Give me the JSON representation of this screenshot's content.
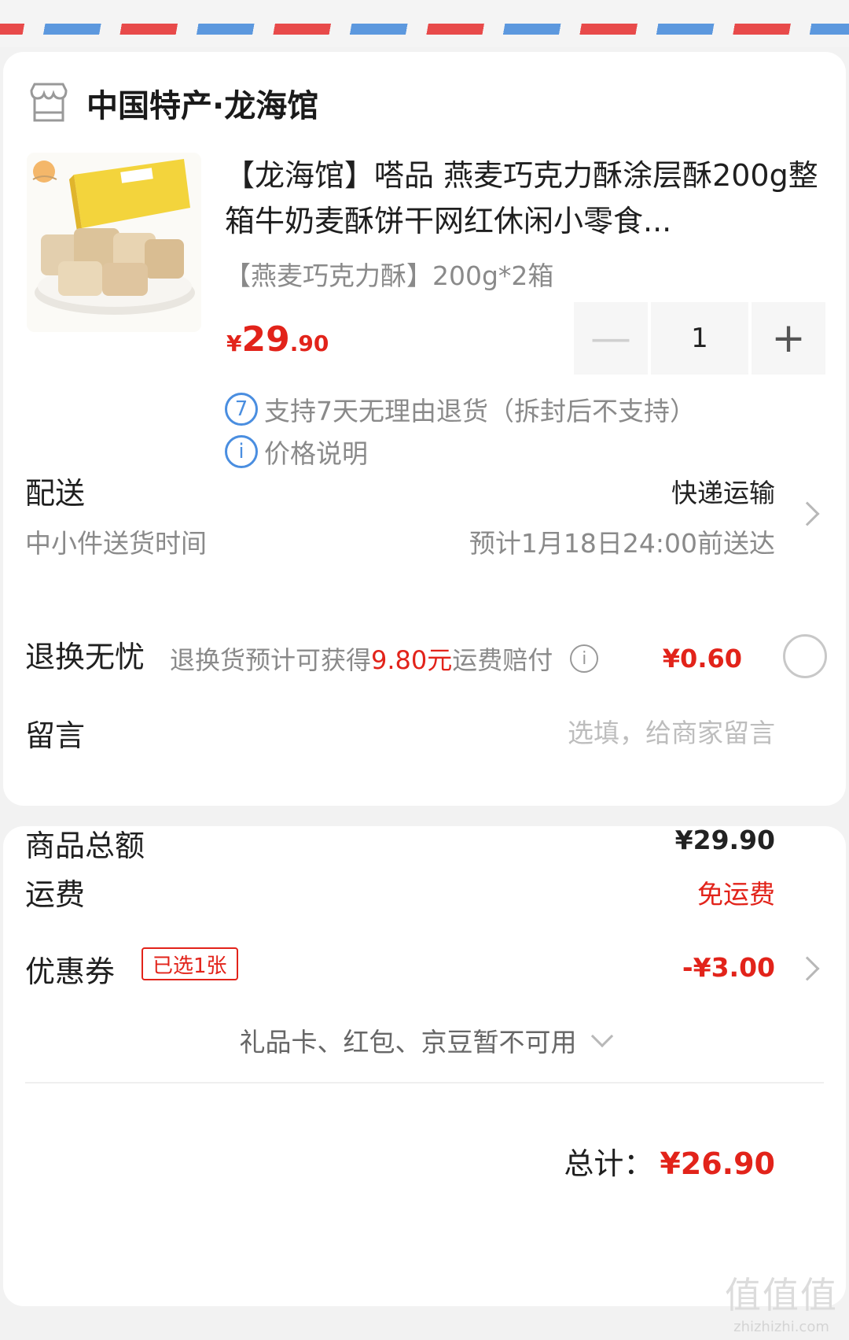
{
  "shop": {
    "name": "中国特产·龙海馆",
    "icon": "store-icon"
  },
  "product": {
    "title": "【龙海馆】嗒品 燕麦巧克力酥涂层酥200g整箱牛奶麦酥饼干网红休闲小零食...",
    "spec": "【燕麦巧克力酥】200g*2箱",
    "price_currency": "¥",
    "price_int": "29",
    "price_dec": ".90",
    "quantity": "1",
    "minus_label": "—",
    "plus_label": "+",
    "return_badge": "7",
    "return_note": "支持7天无理由退货（拆封后不支持）",
    "info_glyph": "i",
    "price_note": "价格说明"
  },
  "delivery": {
    "label": "配送",
    "method": "快递运输",
    "time_label": "中小件送货时间",
    "eta": "预计1月18日24:00前送达"
  },
  "worry_free": {
    "label": "退换无忧",
    "desc_prefix": "退换货预计可获得",
    "desc_amount": "9.80元",
    "desc_suffix": "运费赔付",
    "info_glyph": "i",
    "price": "¥0.60"
  },
  "message": {
    "label": "留言",
    "placeholder": "选填，给商家留言"
  },
  "summary": {
    "goods_label": "商品总额",
    "goods_value": "¥29.90",
    "shipping_label": "运费",
    "shipping_value": "免运费",
    "coupon_label": "优惠券",
    "coupon_badge": "已选1张",
    "coupon_value": "-¥3.00",
    "unavailable": "礼品卡、红包、京豆暂不可用",
    "total_label": "总计：",
    "total_value": "¥26.90"
  },
  "watermark": {
    "glyphs": "值值值",
    "text": "zhizhizhi.com"
  },
  "colors": {
    "accent_red": "#e2231a",
    "info_blue": "#4a8ee0"
  }
}
